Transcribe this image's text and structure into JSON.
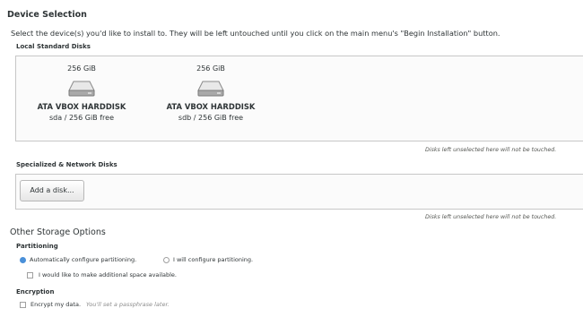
{
  "device_selection": {
    "title": "Device Selection",
    "description": "Select the device(s) you'd like to install to.  They will be left untouched until you click on the main menu's \"Begin Installation\" button."
  },
  "local_disks": {
    "heading": "Local Standard Disks",
    "disks": [
      {
        "size": "256 GiB",
        "name": "ATA VBOX HARDDISK",
        "detail": "sda  /  256 GiB free"
      },
      {
        "size": "256 GiB",
        "name": "ATA VBOX HARDDISK",
        "detail": "sdb  /  256 GiB free"
      }
    ],
    "note": "Disks left unselected here will not be touched."
  },
  "network_disks": {
    "heading": "Specialized & Network Disks",
    "add_button": "Add a disk...",
    "note": "Disks left unselected here will not be touched."
  },
  "other_storage": {
    "title": "Other Storage Options",
    "partitioning": {
      "heading": "Partitioning",
      "auto_label": "Automatically configure partitioning.",
      "manual_label": "I will configure partitioning.",
      "selected": "auto",
      "extra_space_label": "I would like to make additional space available."
    },
    "encryption": {
      "heading": "Encryption",
      "encrypt_label": "Encrypt my data.",
      "hint": "You'll set a passphrase later."
    }
  },
  "colors": {
    "accent": "#4a90d9",
    "panel_border": "#c7c7c7",
    "text": "#2e3436"
  }
}
